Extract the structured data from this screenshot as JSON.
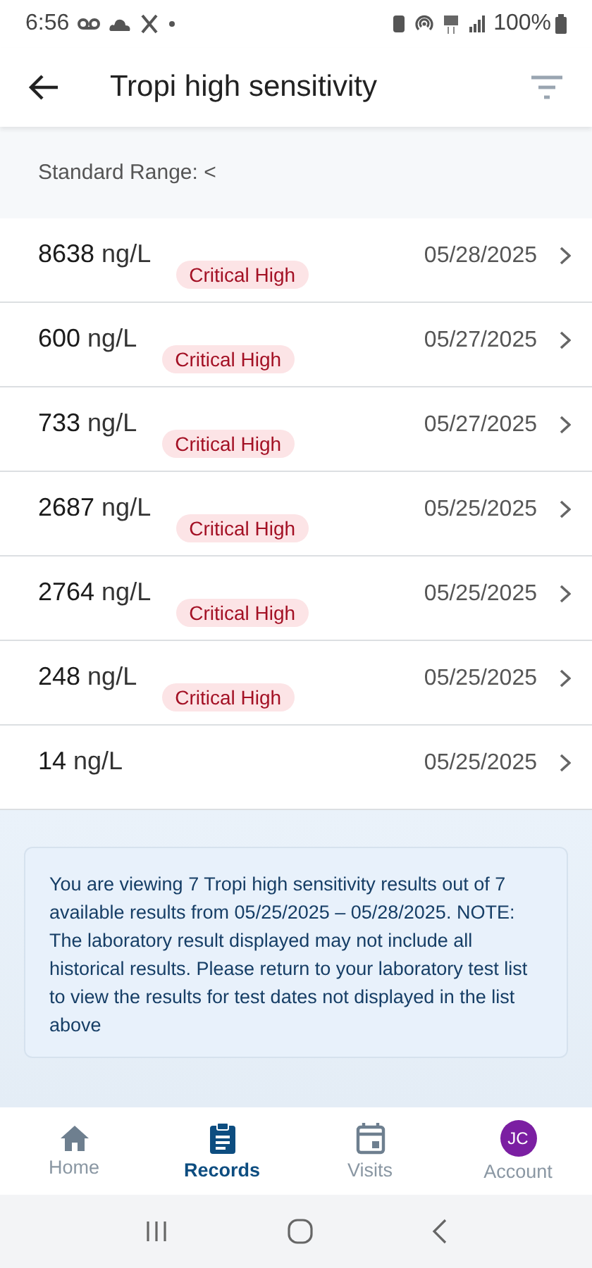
{
  "status_bar": {
    "time": "6:56",
    "battery": "100%"
  },
  "header": {
    "title": "Tropi high sensitivity"
  },
  "standard_range": "Standard Range: <",
  "results": [
    {
      "value": "8638",
      "unit": "ng/L",
      "flag": "Critical High",
      "date": "05/28/2025"
    },
    {
      "value": "600",
      "unit": "ng/L",
      "flag": "Critical High",
      "date": "05/27/2025"
    },
    {
      "value": "733",
      "unit": "ng/L",
      "flag": "Critical High",
      "date": "05/27/2025"
    },
    {
      "value": "2687",
      "unit": "ng/L",
      "flag": "Critical High",
      "date": "05/25/2025"
    },
    {
      "value": "2764",
      "unit": "ng/L",
      "flag": "Critical High",
      "date": "05/25/2025"
    },
    {
      "value": "248",
      "unit": "ng/L",
      "flag": "Critical High",
      "date": "05/25/2025"
    },
    {
      "value": "14",
      "unit": "ng/L",
      "date": "05/25/2025"
    }
  ],
  "note": "You are viewing 7 Tropi high sensitivity results out of 7 available results from 05/25/2025 – 05/28/2025. NOTE: The laboratory result displayed may not include all historical results. Please return to your laboratory test list to view the results for test dates not displayed in the list above",
  "bottom_nav": [
    {
      "kind": "home",
      "label": "Home",
      "selected": false
    },
    {
      "kind": "records",
      "label": "Records",
      "selected": true
    },
    {
      "kind": "visits",
      "label": "Visits",
      "selected": false
    },
    {
      "kind": "avatar",
      "label": "Account",
      "initials": "JC",
      "color": "#7b1fa2",
      "selected": false
    }
  ]
}
